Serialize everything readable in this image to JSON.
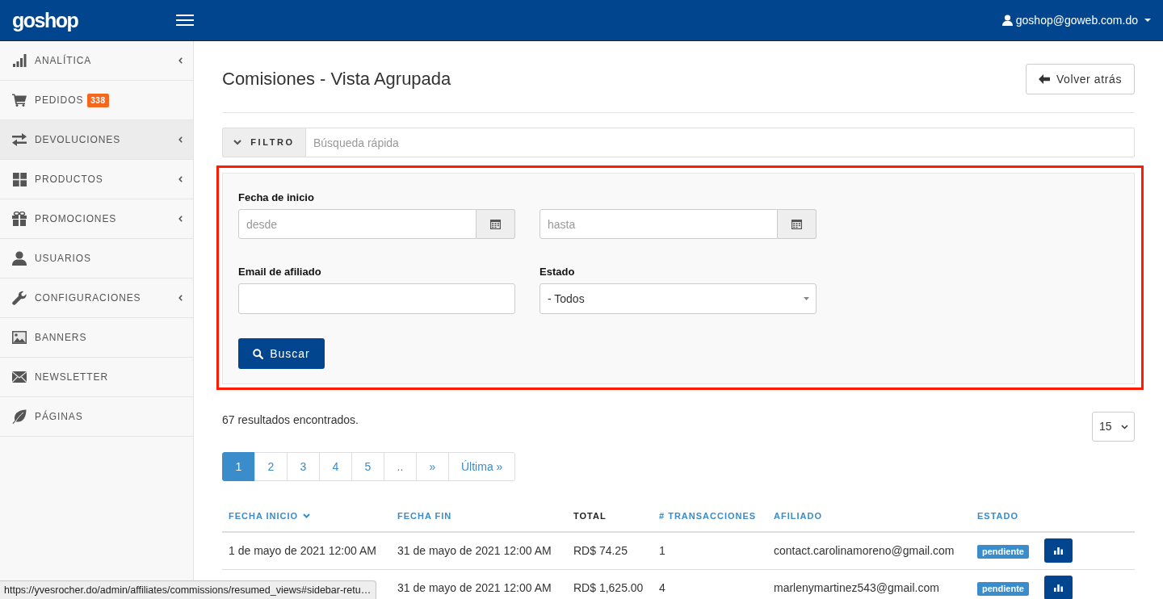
{
  "topbar": {
    "logo": "goshop",
    "user_email": "goshop@goweb.com.do"
  },
  "sidebar": {
    "items": [
      {
        "label": "ANALÍTICA",
        "selected": false,
        "expandable": true
      },
      {
        "label": "PEDIDOS",
        "selected": false,
        "expandable": false,
        "badge": "338"
      },
      {
        "label": "DEVOLUCIONES",
        "selected": true,
        "expandable": true
      },
      {
        "label": "PRODUCTOS",
        "selected": false,
        "expandable": true
      },
      {
        "label": "PROMOCIONES",
        "selected": false,
        "expandable": true
      },
      {
        "label": "USUARIOS",
        "selected": false,
        "expandable": false
      },
      {
        "label": "CONFIGURACIONES",
        "selected": false,
        "expandable": true
      },
      {
        "label": "BANNERS",
        "selected": false,
        "expandable": false
      },
      {
        "label": "NEWSLETTER",
        "selected": false,
        "expandable": false
      },
      {
        "label": "PÁGINAS",
        "selected": false,
        "expandable": false
      }
    ]
  },
  "page": {
    "title": "Comisiones - Vista Agrupada",
    "back_button": "Volver atrás"
  },
  "filter_bar": {
    "label": "FILTRO",
    "expanded": true,
    "search": {
      "placeholder": "Búsqueda rápida"
    }
  },
  "filter_panel": {
    "highlighted": true,
    "start_date": {
      "label": "Fecha de inicio",
      "from": {
        "placeholder": "desde"
      },
      "to": {
        "placeholder": "hasta"
      }
    },
    "affiliate_email": {
      "label": "Email de afiliado"
    },
    "status": {
      "label": "Estado",
      "value": "- Todos"
    },
    "search_button": "Buscar"
  },
  "results": {
    "summary": "67 resultados encontrados.",
    "per_page": "15"
  },
  "pagination": [
    {
      "label": "1",
      "selected": true
    },
    {
      "label": "2",
      "selected": false
    },
    {
      "label": "3",
      "selected": false
    },
    {
      "label": "4",
      "selected": false
    },
    {
      "label": "5",
      "selected": false
    },
    {
      "label": "..",
      "selected": false
    },
    {
      "label": "»",
      "selected": false
    },
    {
      "label": "Última »",
      "selected": false
    }
  ],
  "table": {
    "columns": [
      {
        "label": "FECHA INICIO",
        "sortable": true,
        "sorted": true
      },
      {
        "label": "FECHA FIN",
        "sortable": true,
        "sorted": false
      },
      {
        "label": "TOTAL",
        "sortable": false,
        "sorted": false
      },
      {
        "label": "# TRANSACCIONES",
        "sortable": true,
        "sorted": false
      },
      {
        "label": "AFILIADO",
        "sortable": true,
        "sorted": false
      },
      {
        "label": "ESTADO",
        "sortable": true,
        "sorted": false
      }
    ],
    "rows": [
      {
        "fecha_inicio": "1 de mayo de 2021 12:00 AM",
        "fecha_fin": "31 de mayo de 2021 12:00 AM",
        "total": "RD$ 74.25",
        "transacciones": "1",
        "afiliado": "contact.carolinamoreno@gmail.com",
        "estado": "pendiente"
      },
      {
        "fecha_fin": "31 de mayo de 2021 12:00 AM",
        "total": "RD$ 1,625.00",
        "transacciones": "4",
        "afiliado": "marlenymartinez543@gmail.com",
        "estado": "pendiente"
      }
    ]
  },
  "status_bar": {
    "url": "https://yvesrocher.do/admin/affiliates/commissions/resumed_views#sidebar-retu…"
  }
}
